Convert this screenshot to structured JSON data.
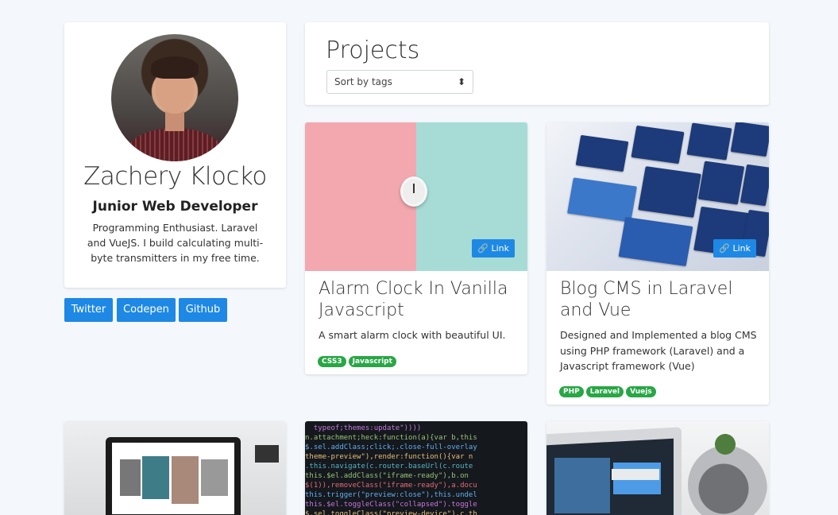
{
  "profile": {
    "name": "Zachery Klocko",
    "title": "Junior Web Developer",
    "description": "Programming Enthusiast. Laravel and VueJS. I build calculating multi-byte transmitters in my free time."
  },
  "social": {
    "twitter": "Twitter",
    "codepen": "Codepen",
    "github": "Github"
  },
  "projects": {
    "heading": "Projects",
    "sort_select": "Sort by tags",
    "link_label": "Link",
    "items": [
      {
        "title": "Alarm Clock In Vanilla Javascript",
        "description": "A smart alarm clock with beautiful UI.",
        "tags": [
          "CSS3",
          "Javascript"
        ]
      },
      {
        "title": "Blog CMS in Laravel and Vue",
        "description": "Designed and Implemented a blog CMS using PHP framework (Laravel) and a Javascript framework (Vue)",
        "tags": [
          "PHP",
          "Laravel",
          "Vuejs"
        ]
      }
    ]
  },
  "colors": {
    "background": "#f4f7fc",
    "primary": "#1e88e5",
    "tag": "#28a745"
  },
  "icons": {
    "link": "link-icon",
    "sort": "sort-arrows-icon"
  }
}
